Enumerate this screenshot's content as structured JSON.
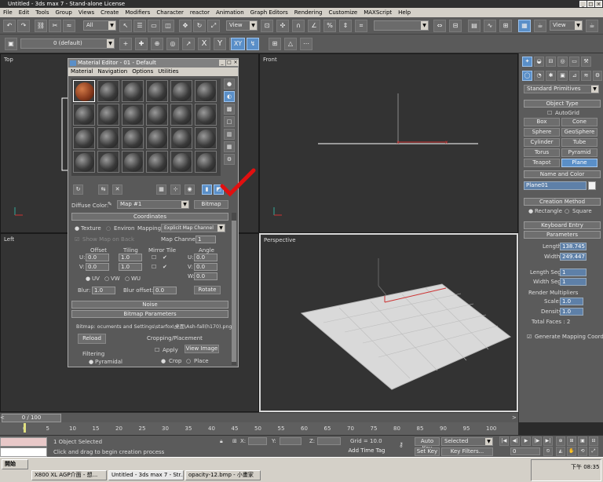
{
  "window": {
    "title": "Untitled - 3ds max 7 - Stand-alone License"
  },
  "menu": [
    "File",
    "Edit",
    "Tools",
    "Group",
    "Views",
    "Create",
    "Modifiers",
    "Character",
    "reactor",
    "Animation",
    "Graph Editors",
    "Rendering",
    "Customize",
    "MAXScript",
    "Help"
  ],
  "toolbar": {
    "selection_filter": "All",
    "ref_coord": "View",
    "layer": "0 (default)",
    "axis_x": "X",
    "axis_y": "Y",
    "axis_z": "Z",
    "axis_xy": "XY",
    "named_sel": "View"
  },
  "viewports": {
    "top": "Top",
    "front": "Front",
    "left": "Left",
    "perspective": "Perspective"
  },
  "material_editor": {
    "title": "Material Editor - 01 - Default",
    "menu": [
      "Material",
      "Navigation",
      "Options",
      "Utilities"
    ],
    "diffuse_label": "Diffuse Color:",
    "map_name": "Map #1",
    "map_type": "Bitmap",
    "coordinates_hdr": "Coordinates",
    "texture_label": "Texture",
    "environ_label": "Environ",
    "mapping_label": "Mapping:",
    "mapping_value": "Explicit Map Channel",
    "show_map_back": "Show Map on Back",
    "map_channel_label": "Map Channel:",
    "map_channel_value": "1",
    "offset_hdr": "Offset",
    "tiling_hdr": "Tiling",
    "mirror_tile_hdr": "Mirror Tile",
    "angle_hdr": "Angle",
    "u_label": "U:",
    "v_label": "V:",
    "w_label": "W:",
    "u_offset": "0.0",
    "v_offset": "0.0",
    "u_tiling": "1.0",
    "v_tiling": "1.0",
    "u_angle": "0.0",
    "v_angle": "0.0",
    "w_angle": "0.0",
    "uv_label": "UV",
    "vw_label": "VW",
    "wu_label": "WU",
    "blur_label": "Blur:",
    "blur_value": "1.0",
    "blur_offset_label": "Blur offset:",
    "blur_offset_value": "0.0",
    "rotate_label": "Rotate",
    "noise_hdr": "Noise",
    "bitmap_params_hdr": "Bitmap Parameters",
    "bitmap_path": "Bitmap:   ocuments and Settings\\starfox\\桌面\\Ash-fall(h170).png",
    "reload_label": "Reload",
    "cropping_hdr": "Cropping/Placement",
    "apply_label": "Apply",
    "view_image_label": "View Image",
    "crop_label": "Crop",
    "place_label": "Place",
    "filtering_hdr": "Filtering",
    "pyramidal_label": "Pyramidal"
  },
  "command_panel": {
    "primitive_type": "Standard Primitives",
    "object_type_hdr": "Object Type",
    "autogrid_label": "AutoGrid",
    "buttons": [
      "Box",
      "Cone",
      "Sphere",
      "GeoSphere",
      "Cylinder",
      "Tube",
      "Torus",
      "Pyramid",
      "Teapot",
      "Plane"
    ],
    "name_color_hdr": "Name and Color",
    "object_name": "Plane01",
    "creation_method_hdr": "Creation Method",
    "rectangle_label": "Rectangle",
    "square_label": "Square",
    "keyboard_entry_hdr": "Keyboard Entry",
    "parameters_hdr": "Parameters",
    "length_label": "Length:",
    "length_value": "138.745",
    "width_label": "Width:",
    "width_value": "249.447",
    "length_segs_label": "Length Segs:",
    "length_segs_value": "1",
    "width_segs_label": "Width Segs:",
    "width_segs_value": "1",
    "render_mult_hdr": "Render Multipliers",
    "scale_label": "Scale:",
    "scale_value": "1.0",
    "density_label": "Density:",
    "density_value": "1.0",
    "total_faces": "Total Faces : 2",
    "gen_mapping": "Generate Mapping Coords."
  },
  "timeline": {
    "frame": "0 / 100",
    "ticks": [
      "0",
      "5",
      "10",
      "15",
      "20",
      "25",
      "30",
      "35",
      "40",
      "45",
      "50",
      "55",
      "60",
      "65",
      "70",
      "75",
      "80",
      "85",
      "90",
      "95",
      "100"
    ]
  },
  "status": {
    "selected": "1 Object Selected",
    "prompt": "Click and drag to begin creation process",
    "x_label": "X:",
    "y_label": "Y:",
    "z_label": "Z:",
    "grid": "Grid = 10.0",
    "add_time_tag": "Add Time Tag",
    "auto_key": "Auto Key",
    "set_key": "Set Key",
    "selected_dd": "Selected",
    "key_filters": "Key Filters...",
    "frame_field": "0"
  },
  "taskbar": {
    "start": "開始",
    "tasks": [
      "X800 XL AGP介面 - 想...",
      "Untitled - 3ds max 7 - Str...",
      "opacity-12.bmp - 小畫家"
    ],
    "clock": "下午 08:35"
  },
  "colors": {
    "accent": "#5a8fc8",
    "checkmark": "#e01010"
  }
}
